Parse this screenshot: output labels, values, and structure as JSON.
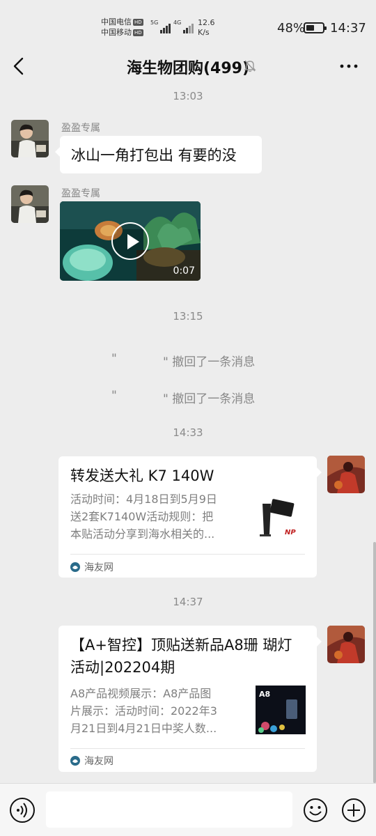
{
  "status_bar": {
    "carrier1": "中国电信",
    "carrier2": "中国移动",
    "hd_badge": "HD",
    "net1": "5G",
    "net2": "4G",
    "speed_value": "12.6",
    "speed_unit": "K/s",
    "battery_percent": "48%",
    "battery_level": 0.48,
    "time": "14:37"
  },
  "header": {
    "title": "海生物团购(499)",
    "icons": [
      "back-icon",
      "mute-bell-icon",
      "more-icon"
    ]
  },
  "messages": {
    "time1": "13:03",
    "sender1": "盈盈专属",
    "text1": "冰山一角打包出 有要的没",
    "sender2": "盈盈专属",
    "video_duration": "0:07",
    "time2": "13:15",
    "recall1_quote": "\"",
    "recall1_text": "\" 撤回了一条消息",
    "recall2_quote": "\"",
    "recall2_text": "\" 撤回了一条消息",
    "time3": "14:33",
    "card1": {
      "title": "转发送大礼 K7 140W",
      "desc_line1": "活动时间：4月18日到5月9日",
      "desc_line2": "送2套K7140W活动规则：把",
      "desc_line3": "本贴活动分享到海水相关的...",
      "source": "海友网"
    },
    "time4": "14:37",
    "card2": {
      "title_line1": "【A+智控】顶贴送新品A8珊 瑚灯",
      "title_line2": "活动|202204期",
      "desc_line1": "A8产品视频展示：A8产品图",
      "desc_line2": "片展示：活动时间：2022年3",
      "desc_line3": "月21日到4月21日中奖人数...",
      "thumb_label": "A8",
      "source": "海友网"
    }
  },
  "bottom_bar": {
    "input_value": "",
    "icons": [
      "voice-icon",
      "emoji-icon",
      "plus-icon"
    ]
  },
  "colors": {
    "background": "#ededed",
    "bubble": "#ffffff",
    "muted_text": "#888888"
  }
}
